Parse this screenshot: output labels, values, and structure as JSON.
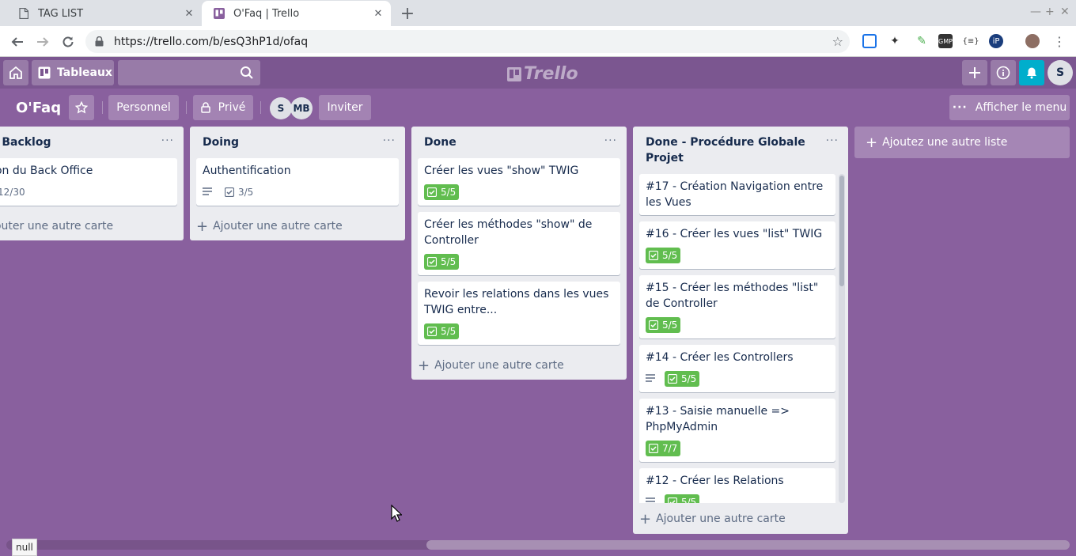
{
  "browser": {
    "tabs": [
      {
        "title": "TAG LIST",
        "active": false
      },
      {
        "title": "O'Faq | Trello",
        "active": true
      }
    ],
    "url": "https://trello.com/b/esQ3hP1d/ofaq",
    "status_text": "null"
  },
  "header": {
    "boards_label": "Tableaux",
    "logo_text": "Trello",
    "user_initial": "S"
  },
  "board": {
    "name": "O'Faq",
    "team_label": "Personnel",
    "visibility_label": "Privé",
    "members": [
      "S",
      "MB"
    ],
    "invite_label": "Inviter",
    "menu_label": "Afficher le menu"
  },
  "lists": [
    {
      "name": "int Backlog",
      "cards": [
        {
          "title": "ation du Back Office",
          "checklist": "12/30",
          "complete": false,
          "has_desc": false
        }
      ],
      "add_card_label": "jouter une autre carte"
    },
    {
      "name": "Doing",
      "cards": [
        {
          "title": "Authentification",
          "checklist": "3/5",
          "complete": false,
          "has_desc": true
        }
      ],
      "add_card_label": "Ajouter une autre carte"
    },
    {
      "name": "Done",
      "cards": [
        {
          "title": "Créer les vues \"show\" TWIG",
          "checklist": "5/5",
          "complete": true,
          "has_desc": false
        },
        {
          "title": "Créer les méthodes \"show\" de Controller",
          "checklist": "5/5",
          "complete": true,
          "has_desc": false
        },
        {
          "title": "Revoir les relations dans les vues TWIG entre...",
          "checklist": "5/5",
          "complete": true,
          "has_desc": false
        }
      ],
      "add_card_label": "Ajouter une autre carte"
    },
    {
      "name": "Done - Procédure Globale Projet",
      "cards": [
        {
          "title": "#17 - Création Navigation entre les Vues",
          "checklist": "",
          "complete": true,
          "has_desc": false
        },
        {
          "title": "#16 - Créer les vues \"list\" TWIG",
          "checklist": "5/5",
          "complete": true,
          "has_desc": false
        },
        {
          "title": "#15 - Créer les méthodes \"list\" de Controller",
          "checklist": "5/5",
          "complete": true,
          "has_desc": false
        },
        {
          "title": "#14 - Créer les Controllers",
          "checklist": "5/5",
          "complete": true,
          "has_desc": true
        },
        {
          "title": "#13 - Saisie manuelle => PhpMyAdmin",
          "checklist": "7/7",
          "complete": true,
          "has_desc": false
        },
        {
          "title": "#12 - Créer les Relations",
          "checklist": "5/5",
          "complete": true,
          "has_desc": true
        }
      ],
      "add_card_label": "Ajouter une autre carte"
    }
  ],
  "add_list_label": "Ajoutez une autre liste",
  "colors": {
    "board_bg": "#89609e",
    "header_bg": "#7b5690",
    "badge_complete": "#61bd4f",
    "notification": "#00aecc"
  }
}
